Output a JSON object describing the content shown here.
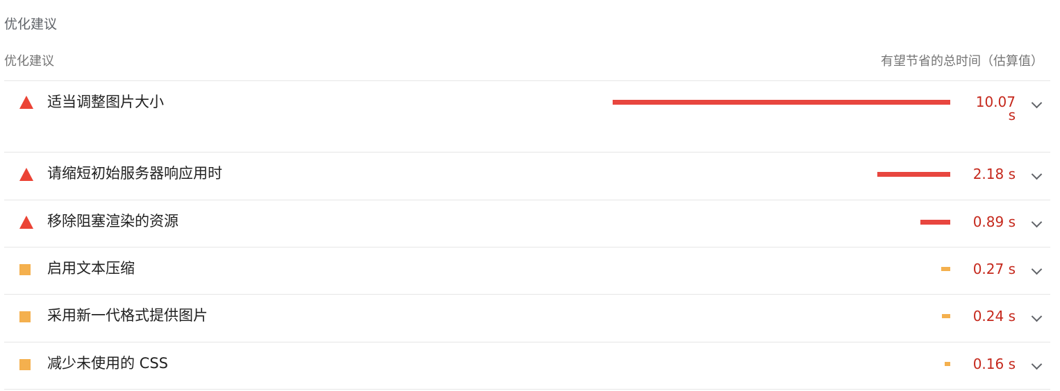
{
  "section": {
    "title": "优化建议"
  },
  "header": {
    "left": "优化建议",
    "right": "有望节省的总时间（估算值）"
  },
  "colors": {
    "fail": "#eb4335",
    "average": "#f4b04e",
    "value_text": "#c5281c"
  },
  "audits": [
    {
      "title": "适当调整图片大小",
      "value": "10.07 s",
      "value_line1": "10.07",
      "value_line2": "s",
      "savings_seconds": 10.07,
      "severity": "fail",
      "icon": "warning-triangle-icon"
    },
    {
      "title": "请缩短初始服务器响应用时",
      "value": "2.18 s",
      "savings_seconds": 2.18,
      "severity": "fail",
      "icon": "warning-triangle-icon"
    },
    {
      "title": "移除阻塞渲染的资源",
      "value": "0.89 s",
      "savings_seconds": 0.89,
      "severity": "fail",
      "icon": "warning-triangle-icon"
    },
    {
      "title": "启用文本压缩",
      "value": "0.27 s",
      "savings_seconds": 0.27,
      "severity": "average",
      "icon": "average-square-icon"
    },
    {
      "title": "采用新一代格式提供图片",
      "value": "0.24 s",
      "savings_seconds": 0.24,
      "severity": "average",
      "icon": "average-square-icon"
    },
    {
      "title": "减少未使用的 CSS",
      "value": "0.16 s",
      "savings_seconds": 0.16,
      "severity": "average",
      "icon": "average-square-icon"
    }
  ]
}
